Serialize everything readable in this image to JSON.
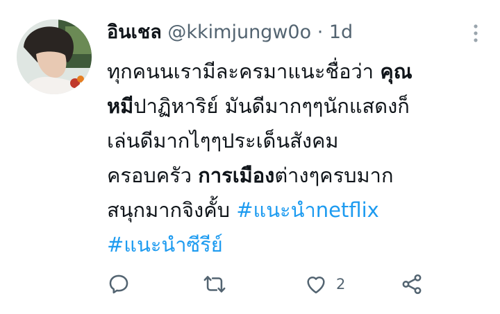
{
  "tweet": {
    "author_name": "อินเชล",
    "handle": "@kkimjungw0o",
    "separator": "·",
    "time": "1d",
    "body": {
      "line1_pre": "ทุกคนนเรามีละครมาแนะชื่อว่า ",
      "line1_bold": "คุณ",
      "line2_bold": "หมี",
      "line2_post": "ปาฏิหาริย์ มันดีมากๆๆนักแสดงก็",
      "line3": "เล่นดีมากไๆๆประเด็นสังคม",
      "line4_pre": "ครอบครัว ",
      "line4_bold": "การเมือง",
      "line4_post": "ต่างๆครบมาก",
      "line5_pre": "สนุกมากจิงคั้บ ",
      "hashtag1": "#แนะนำnetflix",
      "hashtag2": "#แนะนำซีรีย์"
    },
    "actions": {
      "reply_icon": "reply-icon",
      "retweet_icon": "retweet-icon",
      "like_icon": "heart-icon",
      "like_count": "2",
      "share_icon": "share-icon"
    }
  },
  "colors": {
    "text": "#0f1419",
    "muted": "#536471",
    "link": "#1d9bf0"
  }
}
